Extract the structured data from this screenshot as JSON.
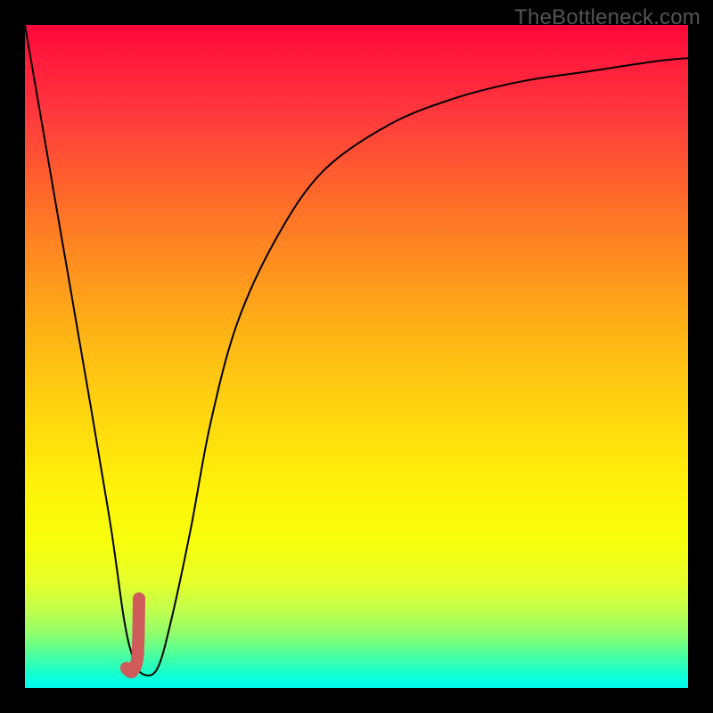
{
  "watermark": "TheBottleneck.com",
  "chart_data": {
    "type": "line",
    "title": "",
    "xlabel": "",
    "ylabel": "",
    "xlim": [
      0,
      100
    ],
    "ylim": [
      0,
      100
    ],
    "grid": false,
    "series": [
      {
        "name": "bottleneck-curve",
        "x": [
          0,
          5,
          10,
          13,
          15,
          16.5,
          18,
          20,
          22,
          25,
          28,
          32,
          38,
          45,
          55,
          65,
          75,
          85,
          95,
          100
        ],
        "y": [
          100,
          71,
          42,
          24,
          10,
          4,
          2,
          3,
          10,
          24,
          40,
          55,
          68,
          78,
          85,
          89,
          91.5,
          93,
          94.5,
          95
        ],
        "color": "#000000",
        "width": 2
      },
      {
        "name": "highlight-segment",
        "x": [
          17.2,
          17.0,
          16.2,
          15.3
        ],
        "y": [
          13.5,
          5.0,
          2.5,
          3.0
        ],
        "color": "#cf5b5b",
        "width": 14,
        "cap": "round"
      }
    ],
    "background_gradient": {
      "stops": [
        {
          "pos": 0.0,
          "color": "#ff073a"
        },
        {
          "pos": 0.5,
          "color": "#ffd50f"
        },
        {
          "pos": 0.8,
          "color": "#f5ff10"
        },
        {
          "pos": 1.0,
          "color": "#05f8ec"
        }
      ]
    }
  }
}
